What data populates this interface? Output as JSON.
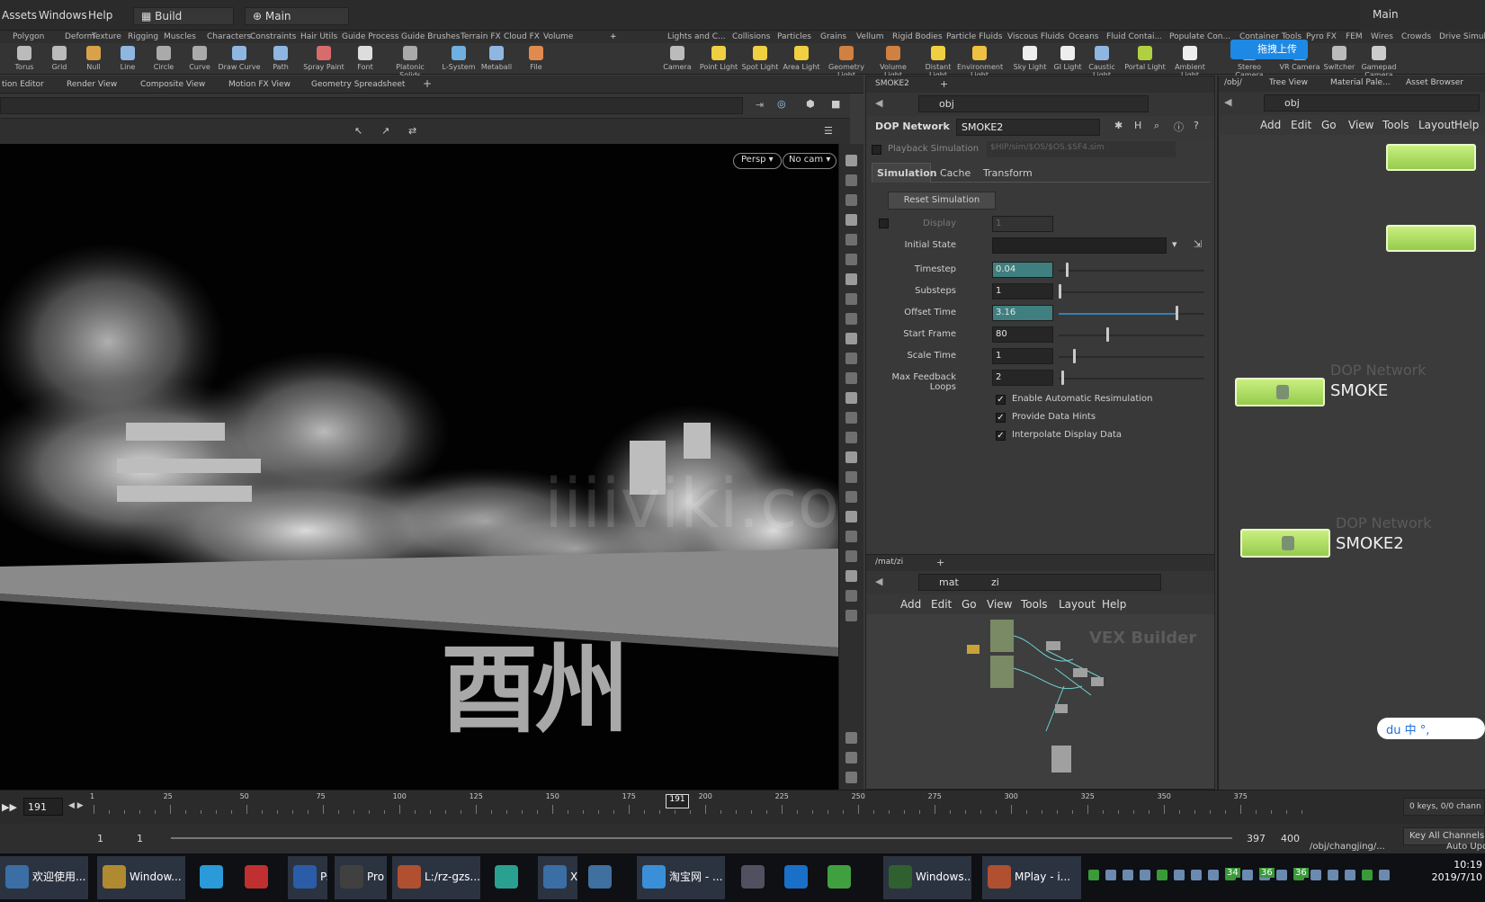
{
  "menubar": {
    "items": [
      "Assets",
      "Windows",
      "Help"
    ],
    "desktop_label": "Build",
    "context_label": "Main",
    "corner_label": "Main"
  },
  "shelf_tabs_left": [
    "Polygon",
    "Deform",
    "Texture",
    "Rigging",
    "Muscles",
    "Characters",
    "Constraints",
    "Hair Utils",
    "Guide Process",
    "Guide Brushes",
    "Terrain FX",
    "Cloud FX",
    "Volume"
  ],
  "shelf_tabs_right": [
    "Lights and C...",
    "Collisions",
    "Particles",
    "Grains",
    "Vellum",
    "Rigid Bodies",
    "Particle Fluids",
    "Viscous Fluids",
    "Oceans",
    "Fluid Contai...",
    "Populate Con...",
    "Container Tools",
    "Pyro FX",
    "FEM",
    "Wires",
    "Crowds",
    "Drive Simula..."
  ],
  "shelf_tools_left": [
    "Torus",
    "Grid",
    "Null",
    "Line",
    "Circle",
    "Curve",
    "Draw Curve",
    "Path",
    "Spray Paint",
    "Font",
    "Platonic Solids",
    "L-System",
    "Metaball",
    "File"
  ],
  "shelf_tools_right": [
    "Camera",
    "Point Light",
    "Spot Light",
    "Area Light",
    "Geometry Light",
    "Volume Light",
    "Distant Light",
    "Environment Light",
    "Sky Light",
    "GI Light",
    "Caustic Light",
    "Portal Light",
    "Ambient Light",
    "Stereo Camera",
    "VR Camera",
    "Switcher",
    "Gamepad Camera"
  ],
  "upload_badge": "拖拽上传",
  "pane_tabs": [
    "tion Editor",
    "Render View",
    "Composite View",
    "Motion FX View",
    "Geometry Spreadsheet"
  ],
  "viewport": {
    "persp": "Persp ▾",
    "cam": "No cam ▾",
    "watermark": "iiiiviki.com",
    "text3d": "酉州"
  },
  "dop_panel": {
    "tab": "SMOKE2",
    "path": "obj",
    "node_type": "DOP Network",
    "node_name": "SMOKE2",
    "playback_label": "Playback Simulation",
    "playback_path": "$HIP/sim/$OS/$OS.$SF4.sim",
    "subtabs": [
      "Simulation",
      "Cache",
      "Transform"
    ],
    "reset_button": "Reset Simulation",
    "display_label": "Display",
    "display_value": "1",
    "initial_state_label": "Initial State",
    "params": [
      {
        "label": "Timestep",
        "value": "0.04",
        "slider": 0.05
      },
      {
        "label": "Substeps",
        "value": "1",
        "slider": 0.0
      },
      {
        "label": "Offset Time",
        "value": "3.16",
        "slider": 0.8
      },
      {
        "label": "Start Frame",
        "value": "80",
        "slider": 0.33
      },
      {
        "label": "Scale Time",
        "value": "1",
        "slider": 0.1
      },
      {
        "label": "Max Feedback Loops",
        "value": "2",
        "slider": 0.02
      }
    ],
    "checkboxes": [
      "Enable Automatic Resimulation",
      "Provide Data Hints",
      "Interpolate Display Data"
    ]
  },
  "mat_panel": {
    "tab": "/mat/zi",
    "path1": "mat",
    "path2": "zi",
    "menu": [
      "Add",
      "Edit",
      "Go",
      "View",
      "Tools",
      "Layout",
      "Help"
    ],
    "label": "VEX Builder"
  },
  "network": {
    "tabs": [
      "/obj/",
      "Tree View",
      "Material Pale...",
      "Asset Browser"
    ],
    "path": "obj",
    "menu": [
      "Add",
      "Edit",
      "Go",
      "View",
      "Tools",
      "Layout",
      "Help"
    ],
    "nodes": [
      {
        "type": "DOP Network",
        "name": "SMOKE"
      },
      {
        "type": "DOP Network",
        "name": "SMOKE2"
      }
    ],
    "ime": "du 中 °,"
  },
  "timeline": {
    "current_frame": "191",
    "marker": "191",
    "ticks": [
      "1",
      "25",
      "50",
      "75",
      "100",
      "125",
      "150",
      "175",
      "200",
      "225",
      "250",
      "275",
      "300",
      "325",
      "350",
      "375"
    ],
    "keys_info": "0 keys, 0/0 chann",
    "key_all": "Key All Channels",
    "range_start": "1",
    "range_start2": "1",
    "range_end": "397",
    "range_end2": "400",
    "status_path": "/obj/changjing/...",
    "auto_update": "Auto Upd"
  },
  "taskbar": {
    "items": [
      "欢迎使用...",
      "Window...",
      "",
      "",
      "Ps",
      "Pro",
      "L:/rz-gzs...",
      "",
      "X",
      "",
      "淘宝网 - ...",
      "",
      "",
      "",
      "Windows...",
      "MPlay - i..."
    ],
    "clock_time": "10:19",
    "clock_date": "2019/7/10",
    "tray_nums": [
      "34",
      "36",
      "36"
    ]
  }
}
